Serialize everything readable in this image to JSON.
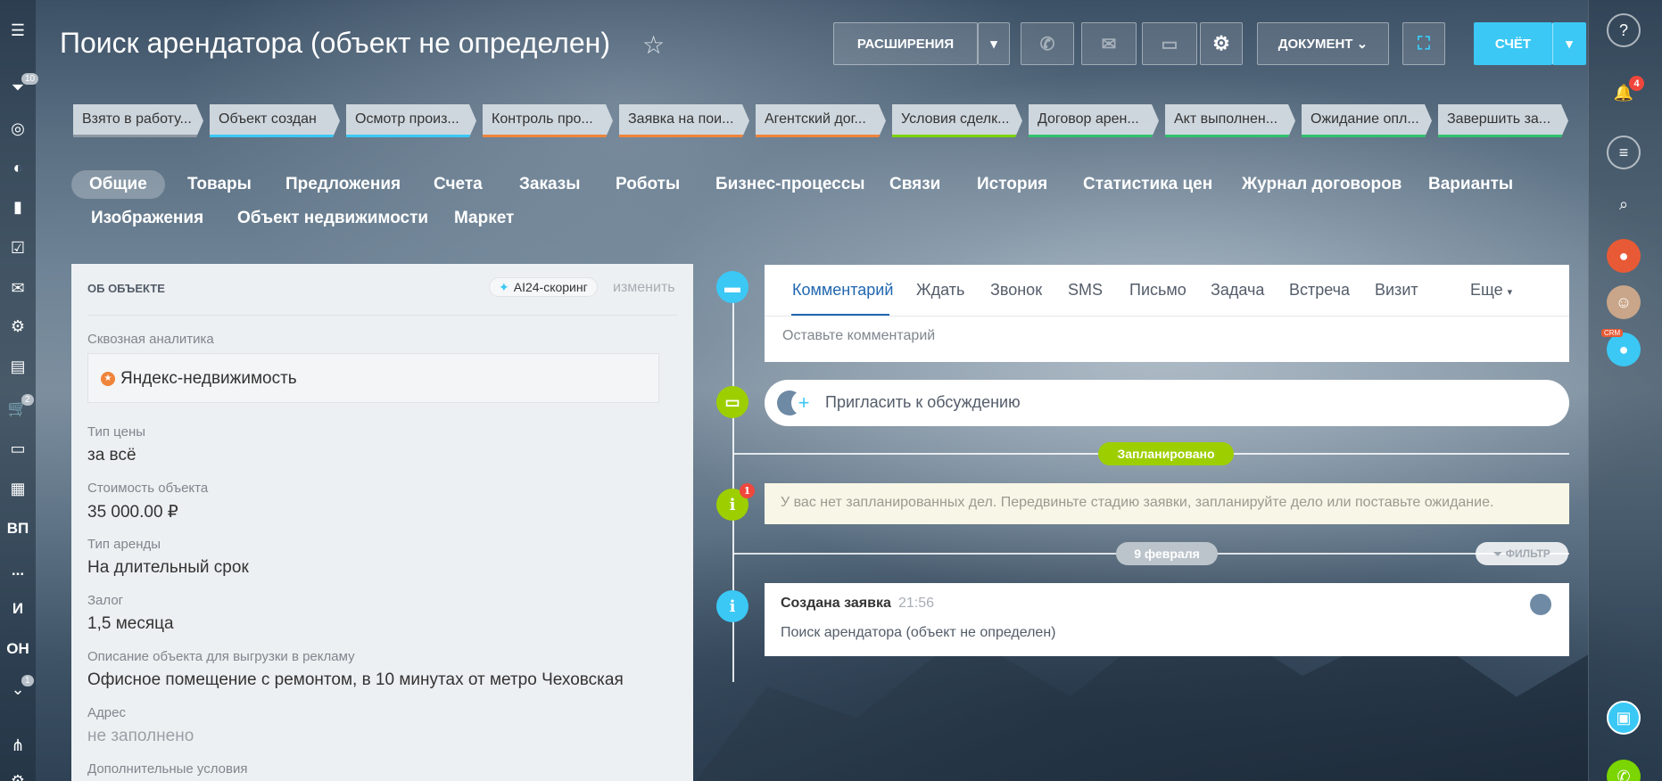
{
  "header": {
    "title": "Поиск арендатора (объект не определен)",
    "extensions_label": "РАСШИРЕНИЯ",
    "document_label": "ДОКУМЕНТ",
    "invoice_label": "СЧЁТ"
  },
  "left_sidebar": {
    "filter_count": "10",
    "cart_count": "2",
    "text_items": [
      "ВП",
      "...",
      "И",
      "ОН"
    ],
    "misc_count": "1"
  },
  "right_sidebar": {
    "notifications_count": "4",
    "crm_badge": "CRM"
  },
  "stages": [
    {
      "label": "Взято в работу...",
      "color": "#8e98a3"
    },
    {
      "label": "Объект создан",
      "color": "#3bc8f5"
    },
    {
      "label": "Осмотр произ...",
      "color": "#3bc8f5"
    },
    {
      "label": "Контроль про...",
      "color": "#f0843b"
    },
    {
      "label": "Заявка на пои...",
      "color": "#f0843b"
    },
    {
      "label": "Агентский дог...",
      "color": "#f0843b"
    },
    {
      "label": "Условия сделк...",
      "color": "#7bd500"
    },
    {
      "label": "Договор арен...",
      "color": "#2fc26e"
    },
    {
      "label": "Акт выполнен...",
      "color": "#2fc26e"
    },
    {
      "label": "Ожидание опл...",
      "color": "#2fc26e"
    },
    {
      "label": "Завершить за...",
      "color": "#2fc26e"
    }
  ],
  "tabs": [
    "Общие",
    "Товары",
    "Предложения",
    "Счета",
    "Заказы",
    "Роботы",
    "Бизнес-процессы",
    "Связи",
    "История",
    "Статистика цен",
    "Журнал договоров",
    "Варианты",
    "Изображения",
    "Объект недвижимости",
    "Маркет"
  ],
  "object_card": {
    "heading": "ОБ ОБЪЕКТЕ",
    "ai_label": "AI24-скоринг",
    "edit_label": "изменить",
    "fields": [
      {
        "label": "Сквозная аналитика",
        "value": "Яндекс-недвижимость"
      },
      {
        "label": "Тип цены",
        "value": "за всё"
      },
      {
        "label": "Стоимость объекта",
        "value": "35 000.00 ₽"
      },
      {
        "label": "Тип аренды",
        "value": "На длительный срок"
      },
      {
        "label": "Залог",
        "value": "1,5 месяца"
      },
      {
        "label": "Описание объекта для выгрузки в рекламу",
        "value": "Офисное помещение с ремонтом, в 10 минутах от метро Чеховская"
      },
      {
        "label": "Адрес",
        "value": "не заполнено"
      },
      {
        "label": "Дополнительные условия",
        "value": ""
      }
    ]
  },
  "timeline": {
    "composer_tabs": [
      "Комментарий",
      "Ждать",
      "Звонок",
      "SMS",
      "Письмо",
      "Задача",
      "Встреча",
      "Визит",
      "Еще"
    ],
    "comment_placeholder": "Оставьте комментарий",
    "invite_label": "Пригласить к обсуждению",
    "planned_label": "Запланировано",
    "planned_badge": "1",
    "planned_notice": "У вас нет запланированных дел. Передвиньте стадию заявки, запланируйте дело или поставьте ожидание.",
    "date_label": "9 февраля",
    "filter_label": "ФИЛЬТР",
    "event_title": "Создана заявка",
    "event_time": "21:56",
    "event_text": "Поиск арендатора (объект не определен)"
  },
  "colors": {
    "accent_blue": "#3bc8f5",
    "planned_green": "#9dcf00",
    "link_blue": "#2067b0"
  }
}
